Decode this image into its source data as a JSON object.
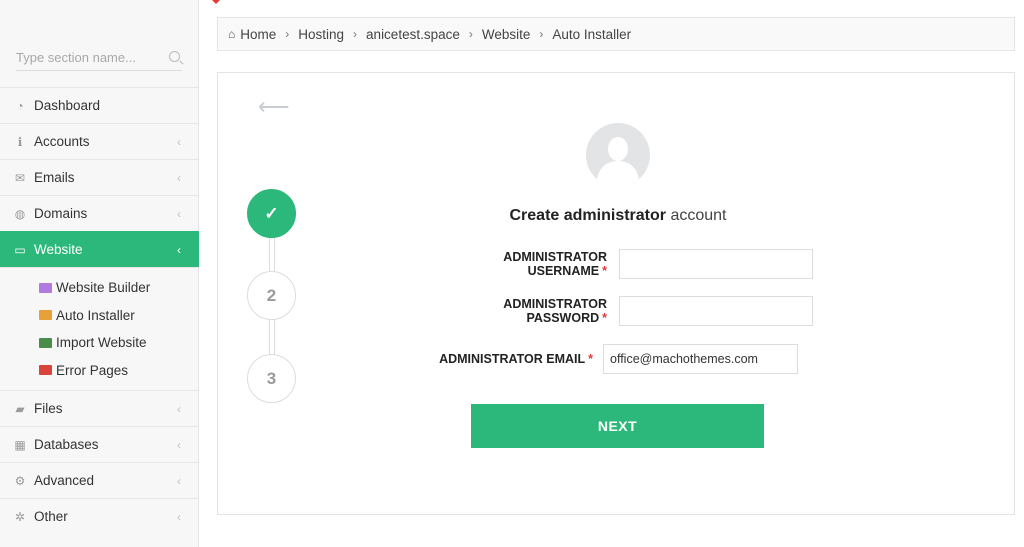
{
  "sidebar": {
    "search_placeholder": "Type section name...",
    "items": [
      {
        "label": "Dashboard",
        "icon": "dashboard-icon"
      },
      {
        "label": "Accounts",
        "icon": "info-icon"
      },
      {
        "label": "Emails",
        "icon": "envelope-icon"
      },
      {
        "label": "Domains",
        "icon": "globe-icon"
      },
      {
        "label": "Website",
        "icon": "monitor-icon",
        "active": true
      },
      {
        "label": "Files",
        "icon": "folder-icon"
      },
      {
        "label": "Databases",
        "icon": "database-icon"
      },
      {
        "label": "Advanced",
        "icon": "gears-icon"
      },
      {
        "label": "Other",
        "icon": "cog-icon"
      }
    ],
    "website_sub": [
      {
        "label": "Website Builder",
        "icon": "website-builder-icon",
        "color": "#b07be0"
      },
      {
        "label": "Auto Installer",
        "icon": "auto-installer-icon",
        "color": "#e8a13a"
      },
      {
        "label": "Import Website",
        "icon": "import-website-icon",
        "color": "#4a8c4a"
      },
      {
        "label": "Error Pages",
        "icon": "error-pages-icon",
        "color": "#d9443a"
      }
    ]
  },
  "breadcrumb": [
    "Home",
    "Hosting",
    "anicetest.space",
    "Website",
    "Auto Installer"
  ],
  "steps": [
    {
      "label": "✓",
      "state": "done"
    },
    {
      "label": "2",
      "state": "pending"
    },
    {
      "label": "3",
      "state": "pending"
    }
  ],
  "form": {
    "title_bold": "Create administrator",
    "title_light": "account",
    "username_label": "ADMINISTRATOR USERNAME",
    "username_value": "",
    "password_label": "ADMINISTRATOR PASSWORD",
    "password_value": "",
    "email_label": "ADMINISTRATOR EMAIL",
    "email_value": "office@machothemes.com",
    "required_mark": "*",
    "next_label": "NEXT"
  },
  "colors": {
    "accent": "#2db87b",
    "required": "#e53935"
  }
}
